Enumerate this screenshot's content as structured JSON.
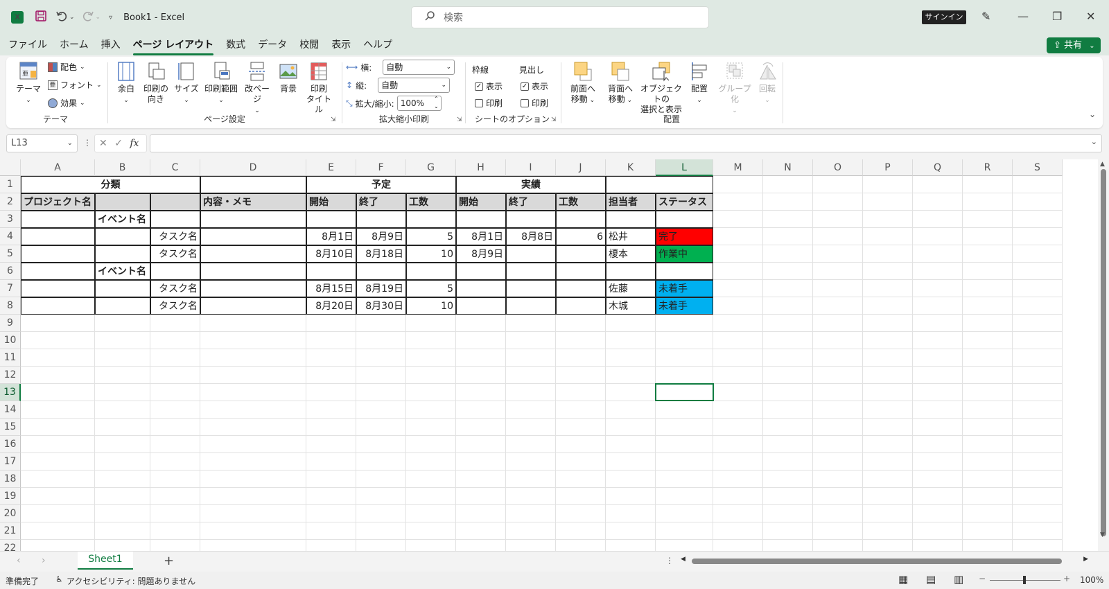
{
  "app": {
    "excel_logo": "X",
    "doc_title": "Book1  -  Excel",
    "search_placeholder": "検索",
    "signin": "サインイン",
    "share": "共有"
  },
  "tabs": [
    "ファイル",
    "ホーム",
    "挿入",
    "ページ レイアウト",
    "数式",
    "データ",
    "校閲",
    "表示",
    "ヘルプ"
  ],
  "active_tab_index": 3,
  "ribbon": {
    "themes": {
      "theme": "テーマ",
      "colors": "配色",
      "fonts": "フォント",
      "effects": "効果",
      "group": "テーマ"
    },
    "page_setup": {
      "margins": "余白",
      "orientation1": "印刷の",
      "orientation2": "向き",
      "size": "サイズ",
      "print_area": "印刷範囲",
      "breaks": "改ページ",
      "background": "背景",
      "titles1": "印刷",
      "titles2": "タイトル",
      "group": "ページ設定"
    },
    "scale": {
      "width_label": "横:",
      "width_value": "自動",
      "height_label": "縦:",
      "height_value": "自動",
      "scale_label": "拡大/縮小:",
      "scale_value": "100%",
      "group": "拡大縮小印刷"
    },
    "sheet_options": {
      "gridlines": "枠線",
      "headings": "見出し",
      "view": "表示",
      "print": "印刷",
      "group": "シートのオプション"
    },
    "arrange": {
      "bring_forward1": "前面へ",
      "bring_forward2": "移動",
      "send_backward1": "背面へ",
      "send_backward2": "移動",
      "selection_pane1": "オブジェクトの",
      "selection_pane2": "選択と表示",
      "align": "配置",
      "group_btn": "グループ化",
      "rotate": "回転",
      "group": "配置"
    }
  },
  "formula_bar": {
    "name_box": "L13",
    "fx": "fx",
    "value": ""
  },
  "columns": [
    "A",
    "B",
    "C",
    "D",
    "E",
    "F",
    "G",
    "H",
    "I",
    "J",
    "K",
    "L",
    "M",
    "N",
    "O",
    "P",
    "Q",
    "R",
    "S"
  ],
  "rows": [
    "1",
    "2",
    "3",
    "4",
    "5",
    "6",
    "7",
    "8",
    "9",
    "10",
    "11",
    "12",
    "13",
    "14",
    "15",
    "16",
    "17",
    "18",
    "19",
    "20",
    "21",
    "22"
  ],
  "table": {
    "h_category": "分類",
    "h_plan": "予定",
    "h_actual": "実績",
    "h_project": "プロジェクト名",
    "h_memo": "内容・メモ",
    "h_start": "開始",
    "h_end": "終了",
    "h_effort": "工数",
    "h_start2": "開始",
    "h_end2": "終了",
    "h_effort2": "工数",
    "h_owner": "担当者",
    "h_status": "ステータス",
    "event": "イベント名",
    "task": "タスク名",
    "r4": {
      "plan_start": "8月1日",
      "plan_end": "8月9日",
      "plan_effort": "5",
      "act_start": "8月1日",
      "act_end": "8月8日",
      "act_effort": "6",
      "owner": "松井",
      "status": "完了"
    },
    "r5": {
      "plan_start": "8月10日",
      "plan_end": "8月18日",
      "plan_effort": "10",
      "act_start": "8月9日",
      "owner": "榎本",
      "status": "作業中"
    },
    "r7": {
      "plan_start": "8月15日",
      "plan_end": "8月19日",
      "plan_effort": "5",
      "owner": "佐藤",
      "status": "未着手"
    },
    "r8": {
      "plan_start": "8月20日",
      "plan_end": "8月30日",
      "plan_effort": "10",
      "owner": "木城",
      "status": "未着手"
    }
  },
  "status_colors": {
    "done": "#ff0000",
    "in_progress": "#00b050",
    "not_started": "#00b0f0"
  },
  "sheet_tab": "Sheet1",
  "statusbar": {
    "ready": "準備完了",
    "accessibility": "アクセシビリティ: 問題ありません",
    "zoom": "100%"
  }
}
